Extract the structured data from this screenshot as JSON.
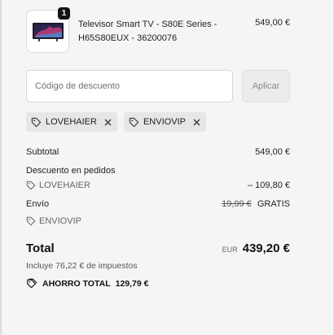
{
  "product": {
    "quantity": "1",
    "title": "Televisor Smart TV - S80E Series - H65S80EUX - 36200076",
    "price": "549,00 €"
  },
  "discount": {
    "placeholder": "Código de descuento",
    "apply_label": "Aplicar",
    "applied_codes": [
      "LOVEHAIER",
      "ENVIOVIP"
    ]
  },
  "summary": {
    "subtotal_label": "Subtotal",
    "subtotal_value": "549,00 €",
    "order_discount_label": "Descuento en pedidos",
    "order_discount_code": "LOVEHAIER",
    "order_discount_value": "– 109,80 €",
    "shipping_label": "Envío",
    "shipping_original": "19,99 €",
    "shipping_value": "GRATIS",
    "shipping_code": "ENVIOVIP",
    "total_label": "Total",
    "currency": "EUR",
    "total_value": "439,20 €",
    "taxes_text": "Incluye 76,22 € de impuestos",
    "savings_label": "AHORRO TOTAL",
    "savings_value": "129,79 €"
  },
  "icons": {
    "tag": "tag-icon",
    "remove": "close-icon",
    "savings": "double-tag-icon"
  }
}
